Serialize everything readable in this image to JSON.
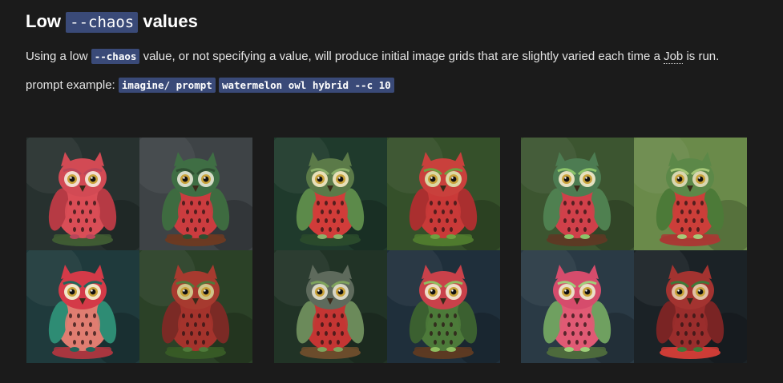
{
  "heading": {
    "prefix": "Low",
    "code": "--chaos",
    "suffix": "values"
  },
  "description": {
    "before": "Using a low",
    "code": "--chaos",
    "middle": "value, or not specifying a value, will produce initial image grids that are slightly varied each time a",
    "link": "Job",
    "after": "is run."
  },
  "example": {
    "label": "prompt example:",
    "chip1": "imagine/ prompt",
    "chip2": "watermelon owl hybrid --c 10"
  },
  "image_grids": [
    {
      "tiles": [
        {
          "subject": "red watermelon owl figurine on stand",
          "bg": "#27312f",
          "body": "#d94e57",
          "wing": "#b63a44",
          "head": "#d24a54",
          "eye_ring": "#f2dcd0",
          "base": "#3f5b33",
          "accent": "#b9465a"
        },
        {
          "subject": "green-headed owl with red belly",
          "bg": "#3e4346",
          "body": "#cb3c3f",
          "wing": "#3e6b40",
          "head": "#3f6e44",
          "eye_ring": "#d6dcc8",
          "base": "#6b3a22",
          "accent": "#2e4f31"
        },
        {
          "subject": "red owl with green wings",
          "bg": "#1f3a3c",
          "body": "#e07d71",
          "wing": "#2e8c74",
          "head": "#d43a48",
          "eye_ring": "#f2e6c8",
          "base": "#a8363f",
          "accent": "#20665a"
        },
        {
          "subject": "dark red owl in foliage",
          "bg": "#2b4127",
          "body": "#a4332c",
          "wing": "#7b2a25",
          "head": "#a73a2f",
          "eye_ring": "#cfc58a",
          "base": "#375a26",
          "accent": "#4f7a3a"
        }
      ]
    },
    {
      "tiles": [
        {
          "subject": "round watermelon owl dark green",
          "bg": "#1f3a2c",
          "body": "#d13c3a",
          "wing": "#5c8a4a",
          "head": "#5b7a48",
          "eye_ring": "#e8e0b8",
          "base": "#2a4a2c",
          "accent": "#8bb06a"
        },
        {
          "subject": "red owl in green forest",
          "bg": "#35502a",
          "body": "#c93a38",
          "wing": "#aa2f2f",
          "head": "#c9403c",
          "eye_ring": "#dad8a4",
          "base": "#4f7a2e",
          "accent": "#6ea040"
        },
        {
          "subject": "grey-headed watermelon owl",
          "bg": "#213326",
          "body": "#c43533",
          "wing": "#6b8a5a",
          "head": "#5e6a5c",
          "eye_ring": "#d8d6c4",
          "base": "#6b4c2c",
          "accent": "#7ea35c"
        },
        {
          "subject": "striped green owl with red face",
          "bg": "#1f2f3b",
          "body": "#4d7a3a",
          "wing": "#3b6030",
          "head": "#c9414a",
          "eye_ring": "#f0ddc8",
          "base": "#5c3a22",
          "accent": "#8fbf60"
        }
      ]
    },
    {
      "tiles": [
        {
          "subject": "green owl with red body and apples",
          "bg": "#3c5530",
          "body": "#d0404a",
          "wing": "#4f8050",
          "head": "#4d7c52",
          "eye_ring": "#e6e1c0",
          "base": "#5c3a24",
          "accent": "#8cc46a"
        },
        {
          "subject": "leafy green owl on watermelon",
          "bg": "#6a8a4a",
          "body": "#cc3e3a",
          "wing": "#4c7a38",
          "head": "#5c8848",
          "eye_ring": "#d8d6b0",
          "base": "#a83a34",
          "accent": "#a6c878"
        },
        {
          "subject": "pink berry owl with green wings",
          "bg": "#2a3a45",
          "body": "#e05a74",
          "wing": "#6fa060",
          "head": "#d64c6c",
          "eye_ring": "#eadfc8",
          "base": "#4d6a3c",
          "accent": "#9fcf7a"
        },
        {
          "subject": "illustrated dark owl in watermelon",
          "bg": "#1b2226",
          "body": "#9a2d2c",
          "wing": "#7a2424",
          "head": "#a33330",
          "eye_ring": "#e0c0a4",
          "base": "#cc3c36",
          "accent": "#3d7a38"
        }
      ]
    }
  ]
}
